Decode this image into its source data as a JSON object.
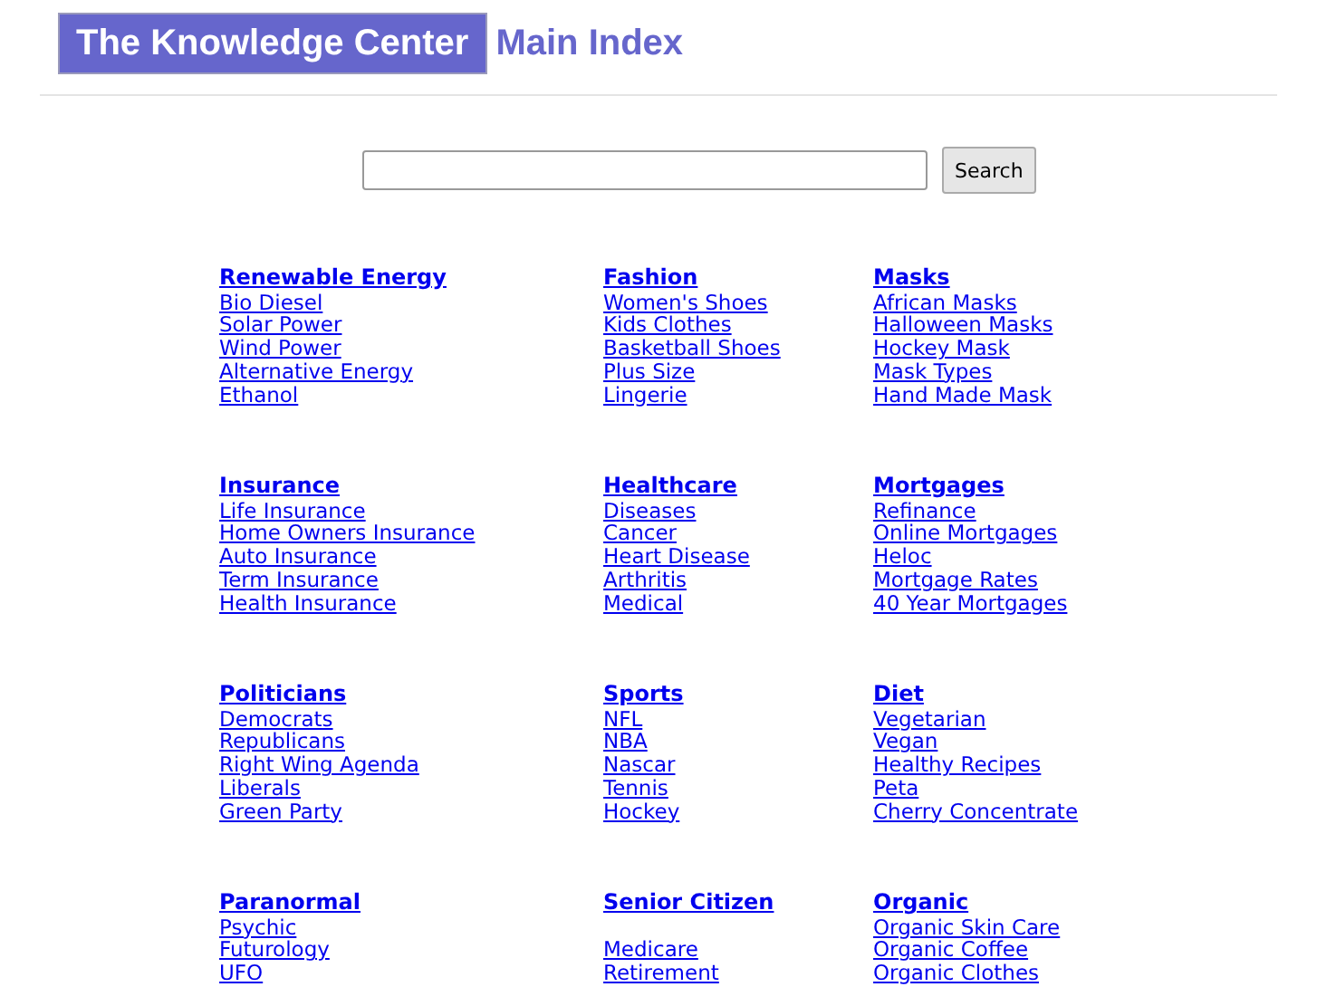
{
  "header": {
    "title": "The Knowledge Center",
    "subtitle": "Main Index"
  },
  "search": {
    "button": "Search"
  },
  "categories": [
    {
      "title": "Renewable Energy",
      "items": [
        {
          "kind": "link",
          "label": "Bio Diesel"
        },
        {
          "kind": "link",
          "label": "Solar Power"
        },
        {
          "kind": "link",
          "label": "Wind Power"
        },
        {
          "kind": "link",
          "label": "Alternative Energy"
        },
        {
          "kind": "link",
          "label": "Ethanol"
        }
      ]
    },
    {
      "title": "Fashion",
      "items": [
        {
          "kind": "link",
          "label": "Women's Shoes"
        },
        {
          "kind": "link",
          "label": "Kids Clothes"
        },
        {
          "kind": "link",
          "label": "Basketball Shoes"
        },
        {
          "kind": "link",
          "label": "Plus Size"
        },
        {
          "kind": "link",
          "label": "Lingerie"
        }
      ]
    },
    {
      "title": "Masks",
      "items": [
        {
          "kind": "link",
          "label": "African Masks"
        },
        {
          "kind": "link",
          "label": "Halloween Masks"
        },
        {
          "kind": "link",
          "label": "Hockey Mask"
        },
        {
          "kind": "link",
          "label": "Mask Types"
        },
        {
          "kind": "link",
          "label": "Hand Made Mask"
        }
      ]
    },
    {
      "title": "Insurance",
      "items": [
        {
          "kind": "link",
          "label": "Life Insurance"
        },
        {
          "kind": "link",
          "label": "Home Owners Insurance"
        },
        {
          "kind": "link",
          "label": "Auto Insurance"
        },
        {
          "kind": "link",
          "label": "Term Insurance"
        },
        {
          "kind": "link",
          "label": "Health Insurance"
        }
      ]
    },
    {
      "title": "Healthcare",
      "items": [
        {
          "kind": "link",
          "label": "Diseases"
        },
        {
          "kind": "link",
          "label": "Cancer"
        },
        {
          "kind": "link",
          "label": "Heart Disease"
        },
        {
          "kind": "link",
          "label": "Arthritis"
        },
        {
          "kind": "link",
          "label": "Medical"
        }
      ]
    },
    {
      "title": "Mortgages",
      "items": [
        {
          "kind": "link",
          "label": "Refinance"
        },
        {
          "kind": "link",
          "label": "Online Mortgages"
        },
        {
          "kind": "link",
          "label": "Heloc"
        },
        {
          "kind": "link",
          "label": "Mortgage Rates"
        },
        {
          "kind": "link",
          "label": "40 Year Mortgages"
        }
      ]
    },
    {
      "title": "Politicians",
      "items": [
        {
          "kind": "link",
          "label": "Democrats"
        },
        {
          "kind": "link",
          "label": "Republicans"
        },
        {
          "kind": "link",
          "label": "Right Wing Agenda"
        },
        {
          "kind": "link",
          "label": "Liberals"
        },
        {
          "kind": "link",
          "label": "Green Party"
        }
      ]
    },
    {
      "title": "Sports",
      "items": [
        {
          "kind": "link",
          "label": "NFL"
        },
        {
          "kind": "link",
          "label": "NBA"
        },
        {
          "kind": "link",
          "label": "Nascar"
        },
        {
          "kind": "link",
          "label": "Tennis"
        },
        {
          "kind": "link",
          "label": "Hockey"
        }
      ]
    },
    {
      "title": "Diet",
      "items": [
        {
          "kind": "link",
          "label": "Vegetarian"
        },
        {
          "kind": "link",
          "label": "Vegan"
        },
        {
          "kind": "link",
          "label": "Healthy Recipes"
        },
        {
          "kind": "link",
          "label": "Peta"
        },
        {
          "kind": "link",
          "label": "Cherry Concentrate"
        }
      ]
    },
    {
      "title": "Paranormal",
      "items": [
        {
          "kind": "link",
          "label": "Psychic"
        },
        {
          "kind": "link",
          "label": "Futurology"
        },
        {
          "kind": "link",
          "label": "UFO"
        }
      ]
    },
    {
      "title": "Senior Citizen",
      "items": [
        {
          "kind": "gap"
        },
        {
          "kind": "link",
          "label": "Medicare"
        },
        {
          "kind": "link",
          "label": "Retirement"
        }
      ]
    },
    {
      "title": "Organic",
      "items": [
        {
          "kind": "link",
          "label": "Organic Skin Care"
        },
        {
          "kind": "link",
          "label": "Organic Coffee"
        },
        {
          "kind": "link",
          "label": "Organic Clothes"
        }
      ]
    }
  ]
}
